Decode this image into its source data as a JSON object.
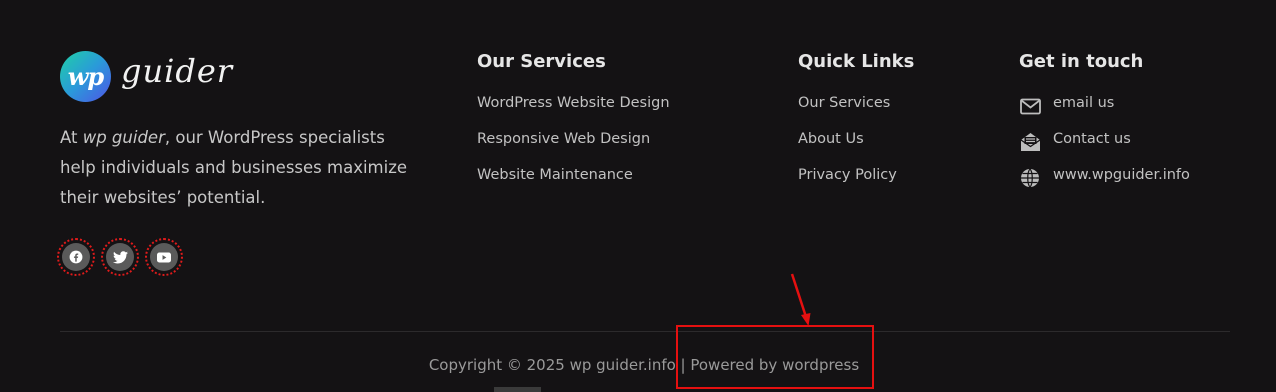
{
  "brand": {
    "logo_badge": "wp",
    "logo_word": "guider",
    "about_prefix": "At ",
    "about_em": "wp guider",
    "about_rest": ", our WordPress specialists help individuals and businesses maximize their websites’ potential.",
    "socials": [
      "facebook-icon",
      "twitter-icon",
      "youtube-icon"
    ]
  },
  "services": {
    "heading": "Our Services",
    "items": [
      "WordPress Website Design",
      "Responsive Web Design",
      "Website Maintenance"
    ]
  },
  "quick_links": {
    "heading": "Quick Links",
    "items": [
      "Our Services",
      "About Us",
      "Privacy Policy"
    ]
  },
  "contact": {
    "heading": "Get in touch",
    "items": [
      {
        "icon": "envelope-icon",
        "label": "email us"
      },
      {
        "icon": "open-mail-icon",
        "label": "Contact us"
      },
      {
        "icon": "globe-icon",
        "label": "www.wpguider.info"
      }
    ]
  },
  "footer": {
    "copyright": "Copyright © 2025 wp guider.info | Powered by wordpress"
  },
  "colors": {
    "background": "#141214",
    "annotation": "#e51010",
    "logo_gradient": [
      "#1fd1a6",
      "#4f53e6"
    ]
  }
}
